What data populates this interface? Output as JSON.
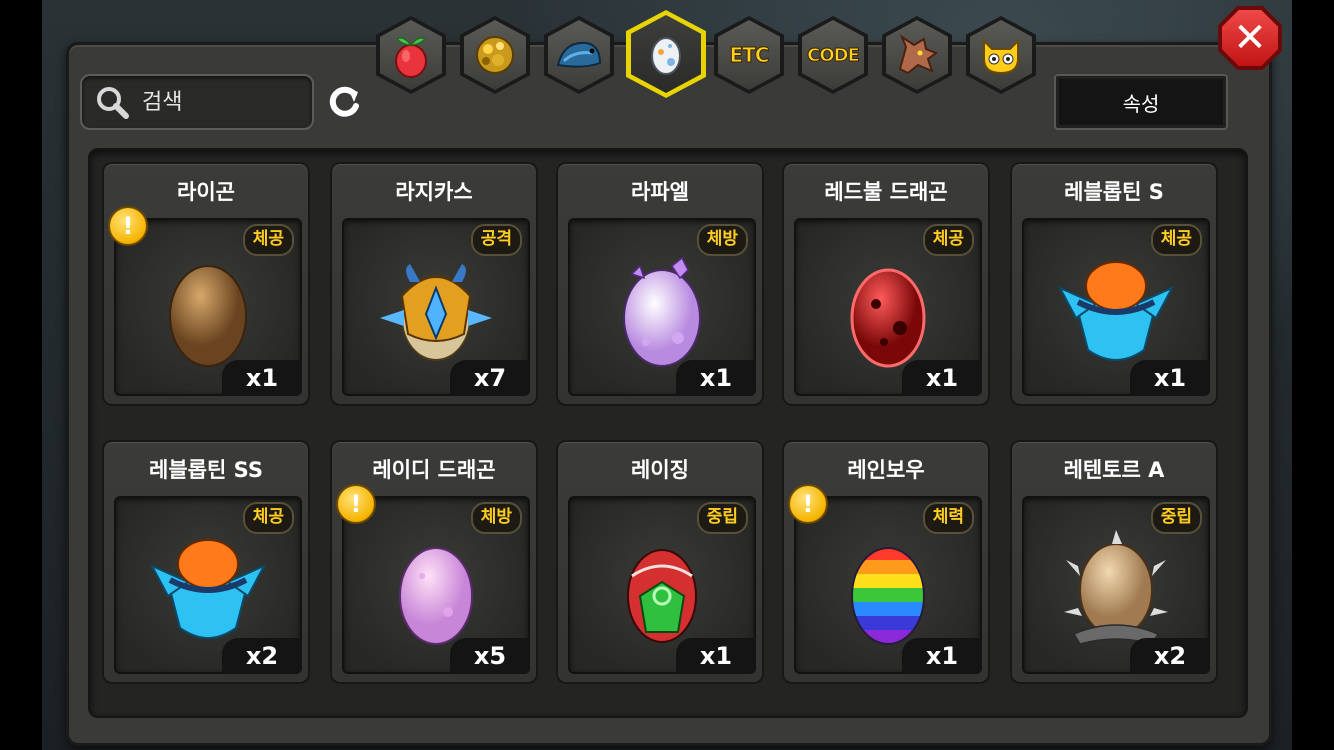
{
  "tabs": [
    {
      "id": "fruit",
      "icon": "fruit-icon",
      "text": ""
    },
    {
      "id": "ore",
      "icon": "gold-ore-icon",
      "text": ""
    },
    {
      "id": "fish",
      "icon": "fish-icon",
      "text": ""
    },
    {
      "id": "egg",
      "icon": "egg-icon",
      "text": "",
      "active": true
    },
    {
      "id": "etc",
      "icon": "",
      "text": "ETC"
    },
    {
      "id": "code",
      "icon": "",
      "text": "CODE"
    },
    {
      "id": "dragon",
      "icon": "dragon-head-icon",
      "text": ""
    },
    {
      "id": "monster",
      "icon": "yellow-monster-icon",
      "text": ""
    }
  ],
  "search": {
    "placeholder": "검색"
  },
  "attribute_button": "속성",
  "items": [
    {
      "name": "라이곤",
      "attr": "체공",
      "qty": "x1",
      "warn": true,
      "egg": "brown"
    },
    {
      "name": "라지카스",
      "attr": "공격",
      "qty": "x7",
      "warn": false,
      "egg": "armored"
    },
    {
      "name": "라파엘",
      "attr": "체방",
      "qty": "x1",
      "warn": false,
      "egg": "crystal"
    },
    {
      "name": "레드불 드래곤",
      "attr": "체공",
      "qty": "x1",
      "warn": false,
      "egg": "red"
    },
    {
      "name": "레블롭틴 S",
      "attr": "체공",
      "qty": "x1",
      "warn": false,
      "egg": "blue-cap"
    },
    {
      "name": "레블롭틴 SS",
      "attr": "체공",
      "qty": "x2",
      "warn": false,
      "egg": "blue-cap"
    },
    {
      "name": "레이디 드래곤",
      "attr": "체방",
      "qty": "x5",
      "warn": true,
      "egg": "pink"
    },
    {
      "name": "레이징",
      "attr": "중립",
      "qty": "x1",
      "warn": false,
      "egg": "raging"
    },
    {
      "name": "레인보우",
      "attr": "체력",
      "qty": "x1",
      "warn": true,
      "egg": "rainbow"
    },
    {
      "name": "레텐토르 A",
      "attr": "중립",
      "qty": "x2",
      "warn": false,
      "egg": "spiky"
    }
  ]
}
